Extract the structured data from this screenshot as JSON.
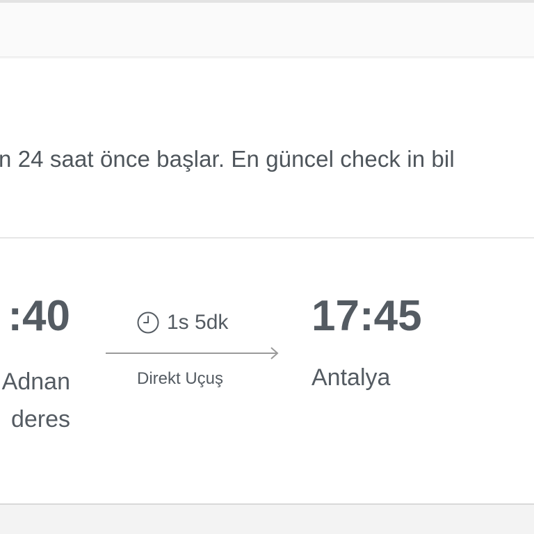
{
  "checkin_info": "n 24 saat önce başlar. En güncel check in bil",
  "flight": {
    "departure": {
      "time": ":40",
      "city_line1": "Adnan",
      "city_line2": "deres"
    },
    "duration": "1s 5dk",
    "flight_type": "Direkt Uçuş",
    "arrival": {
      "time": "17:45",
      "city": "Antalya"
    }
  },
  "icons": {
    "clock": "clock-icon",
    "arrow": "arrow-right-icon"
  },
  "colors": {
    "text": "#545b62",
    "arrow": "#9a9a9a",
    "divider": "#e6e6e6"
  }
}
